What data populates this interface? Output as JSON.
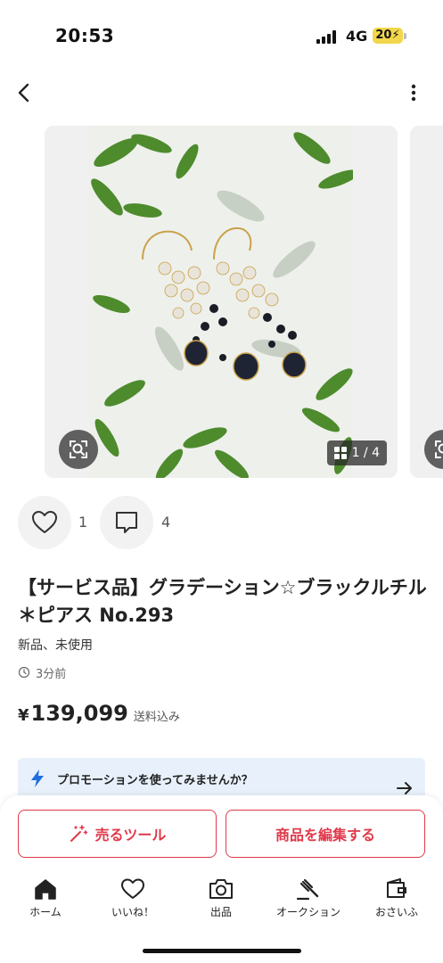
{
  "status_bar": {
    "time": "20:53",
    "network": "4G",
    "battery": "20"
  },
  "header": {
    "back_icon": "chevron-left-icon",
    "more_icon": "more-vertical-icon"
  },
  "gallery": {
    "page_counter": "1 / 4",
    "lens_icon": "image-search-icon"
  },
  "actions": {
    "like_count": "1",
    "comment_count": "4"
  },
  "item": {
    "title": "【サービス品】グラデーション☆ブラックルチル＊ピアス No.293",
    "condition": "新品、未使用",
    "posted": "3分前",
    "price_symbol": "¥",
    "price": "139,099",
    "shipping": "送料込み"
  },
  "promotion": {
    "text": "プロモーションを使ってみませんか？"
  },
  "buttons": {
    "sell_tools": "売るツール",
    "edit_item": "商品を編集する"
  },
  "tabs": [
    {
      "label": "ホーム",
      "icon": "home-icon"
    },
    {
      "label": "いいね！",
      "icon": "heart-icon"
    },
    {
      "label": "出品",
      "icon": "camera-icon"
    },
    {
      "label": "オークション",
      "icon": "gavel-icon"
    },
    {
      "label": "おさいふ",
      "icon": "wallet-icon"
    }
  ],
  "colors": {
    "accent": "#e0394a",
    "promo_bg": "#e8f1fb",
    "promo_icon": "#1f6fe0",
    "battery": "#f2d64b"
  }
}
